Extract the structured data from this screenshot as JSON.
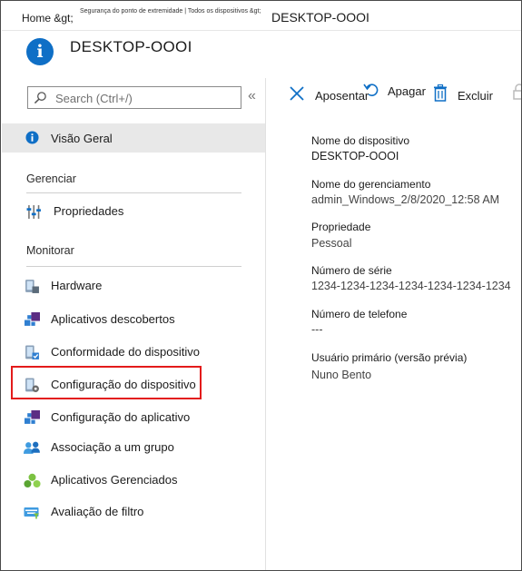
{
  "breadcrumb": {
    "home": "Home &gt;",
    "section": "Segurança do ponto de extremidade | Todos os dispositivos &gt;",
    "current": "DESKTOP-OOOI"
  },
  "header": {
    "title": "DESKTOP-OOOI",
    "icon": "info-icon"
  },
  "sidebar": {
    "search_placeholder": "Search (Ctrl+/)",
    "collapse_glyph": "«",
    "overview": "Visão Geral",
    "sections": [
      {
        "title": "Gerenciar",
        "items": [
          {
            "label": "Propriedades",
            "icon": "properties-icon"
          }
        ]
      },
      {
        "title": "Monitorar",
        "items": [
          {
            "label": "Hardware",
            "icon": "hardware-icon"
          },
          {
            "label": "Aplicativos descobertos",
            "icon": "discovered-apps-icon"
          },
          {
            "label": "Conformidade do dispositivo",
            "icon": "device-compliance-icon"
          },
          {
            "label": "Configuração do dispositivo",
            "icon": "device-configuration-icon"
          },
          {
            "label": "Configuração do aplicativo",
            "icon": "app-configuration-icon"
          },
          {
            "label": "Associação a um grupo",
            "icon": "group-membership-icon"
          },
          {
            "label": "Aplicativos Gerenciados",
            "icon": "managed-apps-icon"
          },
          {
            "label": "Avaliação de filtro",
            "icon": "filter-evaluation-icon"
          }
        ]
      }
    ]
  },
  "toolbar": {
    "retire": "Aposentar",
    "wipe": "Apagar",
    "delete": "Excluir"
  },
  "details": {
    "device_name_label": "Nome do dispositivo",
    "device_name": "DESKTOP-OOOI",
    "management_name_label": "Nome do gerenciamento",
    "management_name": "admin_Windows_2/8/2020_12:58 AM",
    "ownership_label": "Propriedade",
    "ownership": "Pessoal",
    "serial_label": "Número de série",
    "serial": "1234-1234-1234-1234-1234-1234-1234",
    "phone_label": "Número de telefone",
    "phone": "---",
    "primary_user_label": "Usuário primário (versão prévia)",
    "primary_user": "Nuno Bento"
  },
  "colors": {
    "accent": "#0f6fc6",
    "highlight": "#e31b1b",
    "selected_bg": "#e8e8e8"
  }
}
